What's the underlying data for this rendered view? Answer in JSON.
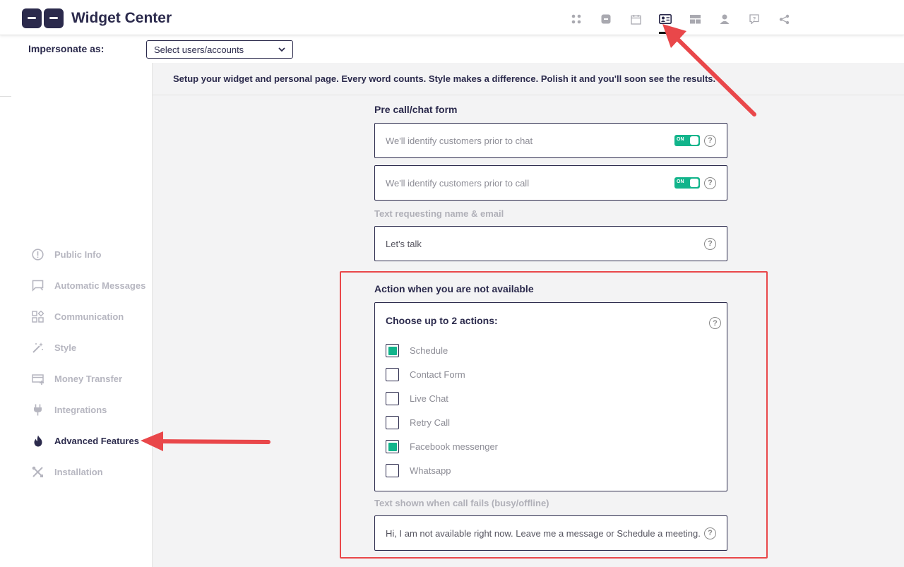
{
  "app": {
    "title": "Widget Center"
  },
  "topnav": {
    "icons": [
      "apps-icon",
      "widget-icon",
      "calendar-icon",
      "contact-card-icon",
      "layout-icon",
      "user-icon",
      "help-chat-icon",
      "share-icon"
    ],
    "active": "contact-card-icon"
  },
  "impersonate": {
    "label": "Impersonate as:",
    "select_value": "Select users/accounts"
  },
  "sidebar": {
    "items": [
      {
        "label": "Public Info",
        "icon": "info-icon"
      },
      {
        "label": "Automatic Messages",
        "icon": "message-icon"
      },
      {
        "label": "Communication",
        "icon": "grid-shapes-icon"
      },
      {
        "label": "Style",
        "icon": "magic-wand-icon"
      },
      {
        "label": "Money Transfer",
        "icon": "payment-icon"
      },
      {
        "label": "Integrations",
        "icon": "plug-icon"
      },
      {
        "label": "Advanced Features",
        "icon": "flame-icon"
      },
      {
        "label": "Installation",
        "icon": "tools-icon"
      }
    ],
    "active_index": 6
  },
  "main": {
    "intro": "Setup your widget and personal page. Every word counts. Style makes a difference. Polish it and you'll soon see the results.",
    "pre_call": {
      "title": "Pre call/chat form",
      "chat_text": "We'll identify customers prior to chat",
      "call_text": "We'll identify customers prior to call",
      "toggle_label": "ON",
      "name_email_label": "Text requesting name & email",
      "name_email_value": "Let's talk"
    },
    "not_available": {
      "title": "Action when you are not available",
      "choose_label": "Choose up to 2 actions:",
      "options": [
        {
          "label": "Schedule",
          "checked": true
        },
        {
          "label": "Contact Form",
          "checked": false
        },
        {
          "label": "Live Chat",
          "checked": false
        },
        {
          "label": "Retry Call",
          "checked": false
        },
        {
          "label": "Facebook messenger",
          "checked": true
        },
        {
          "label": "Whatsapp",
          "checked": false
        }
      ],
      "fail_label": "Text shown when call fails (busy/offline)",
      "fail_value": "Hi, I am not available right now. Leave me a message or Schedule a meeting."
    },
    "help_symbol": "?"
  },
  "colors": {
    "primary": "#2b2a4c",
    "accent": "#12b48b",
    "annotation": "#e9474a"
  }
}
